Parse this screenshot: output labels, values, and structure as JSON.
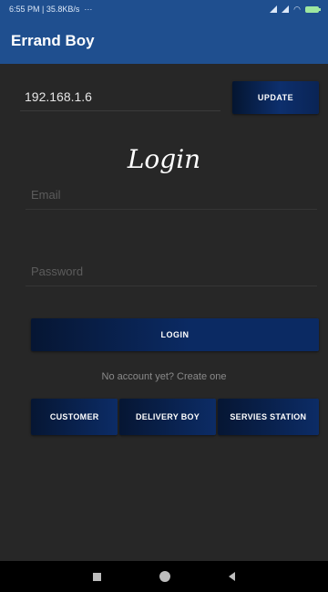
{
  "status_bar": {
    "time": "6:55 PM | 35.8KB/s",
    "extra": "···"
  },
  "app_bar": {
    "title": "Errand Boy"
  },
  "server": {
    "ip_value": "192.168.1.6",
    "update_label": "UPDATE"
  },
  "login": {
    "title": "Login",
    "email_placeholder": "Email",
    "password_placeholder": "Password",
    "login_label": "LOGIN",
    "register_text": "No account yet? Create one"
  },
  "roles": [
    "CUSTOMER",
    "DELIVERY BOY",
    "SERVIES STATION"
  ],
  "colors": {
    "primary": "#1f4f8f",
    "background": "#272727",
    "button_dark": "#061633",
    "button_mid": "#0b2a63"
  }
}
